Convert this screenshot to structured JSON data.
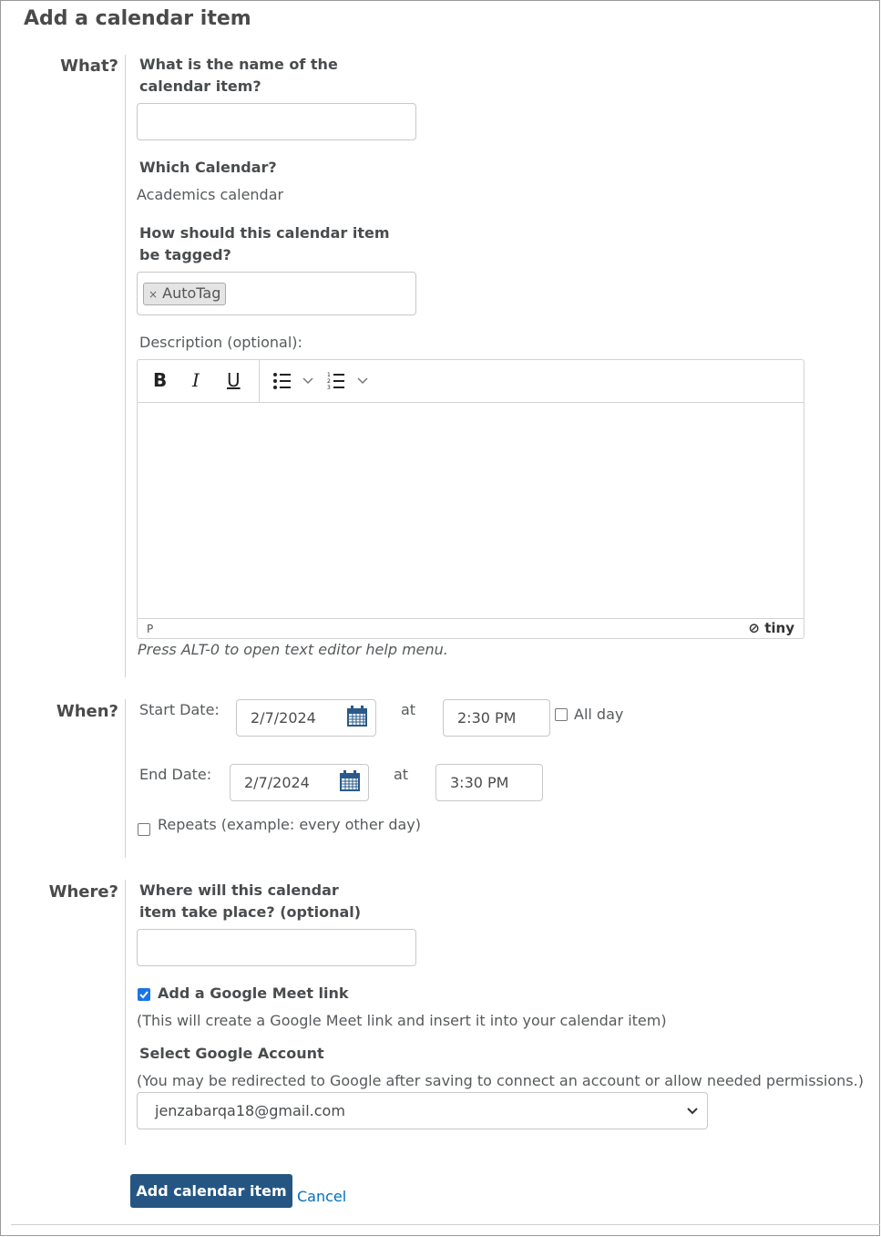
{
  "title": "Add a calendar item",
  "what": {
    "heading": "What?",
    "name_label": "What is the name of the calendar item?",
    "name_value": "",
    "calendar_label": "Which Calendar?",
    "calendar_value": "Academics calendar",
    "tag_label": "How should this calendar item be tagged?",
    "tags": [
      {
        "remove": "×",
        "label": "AutoTag"
      }
    ],
    "description_label": "Description (optional):",
    "editor": {
      "bold": "B",
      "italic": "I",
      "underline": "U",
      "path": "P",
      "brand": "tiny"
    },
    "editor_help": "Press ALT-0 to open text editor help menu."
  },
  "when": {
    "heading": "When?",
    "start_label": "Start Date:",
    "start_date": "2/7/2024",
    "at": "at",
    "start_time": "2:30 PM",
    "all_day_label": "All day",
    "all_day": false,
    "end_label": "End Date:",
    "end_date": "2/7/2024",
    "end_time": "3:30 PM",
    "repeats_label": "Repeats (example: every other day)",
    "repeats": false
  },
  "where": {
    "heading": "Where?",
    "location_label": "Where will this calendar item take place? (optional)",
    "location_value": "",
    "meet_label": "Add a Google Meet link",
    "meet_checked": true,
    "meet_note": "(This will create a Google Meet link and insert it into your calendar item)",
    "account_label": "Select Google Account",
    "account_note": "(You may be redirected to Google after saving to connect an account or allow needed permissions.)",
    "account_value": "jenzabarqa18@gmail.com"
  },
  "actions": {
    "submit": "Add calendar item",
    "cancel": "Cancel"
  },
  "colors": {
    "primary": "#255683",
    "icon": "#2a5a8a",
    "link": "#006fbf"
  }
}
